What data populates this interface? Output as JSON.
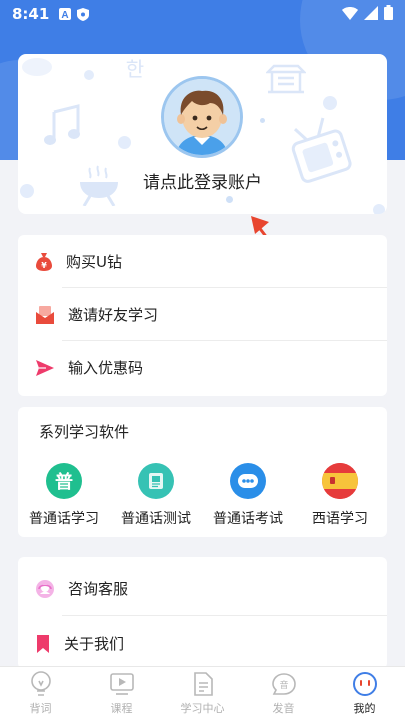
{
  "status_bar": {
    "time": "8:41",
    "left_icons": [
      "a-notification-icon",
      "shield-icon"
    ],
    "right_icons": [
      "wifi-icon",
      "signal-icon",
      "battery-icon"
    ]
  },
  "profile": {
    "login_prompt": "请点此登录账户"
  },
  "menu1": {
    "items": [
      {
        "label": "购买U钻",
        "icon": "money-bag-icon",
        "color": "#e94b3c"
      },
      {
        "label": "邀请好友学习",
        "icon": "invite-envelope-icon",
        "color": "#e94b3c"
      },
      {
        "label": "输入优惠码",
        "icon": "paper-plane-icon",
        "color": "#ee3b6b"
      }
    ]
  },
  "series": {
    "title": "系列学习软件",
    "apps": [
      {
        "label": "普通话学习",
        "icon": "mandarin-learn-icon",
        "glyph": "普",
        "color": "#1fbf8f"
      },
      {
        "label": "普通话测试",
        "icon": "mandarin-test-icon",
        "color": "#36c2b4"
      },
      {
        "label": "普通话考试",
        "icon": "mandarin-exam-icon",
        "color": "#2a8ee8"
      },
      {
        "label": "西语学习",
        "icon": "spain-flag-icon",
        "color": "#e63b3b"
      }
    ]
  },
  "menu2": {
    "items": [
      {
        "label": "咨询客服",
        "icon": "customer-service-icon",
        "color": "#e86fc9"
      },
      {
        "label": "关于我们",
        "icon": "bookmark-icon",
        "color": "#ee3b6b"
      }
    ]
  },
  "nav": {
    "items": [
      {
        "label": "背词",
        "icon": "lightbulb-icon"
      },
      {
        "label": "课程",
        "icon": "play-course-icon"
      },
      {
        "label": "学习中心",
        "icon": "document-icon"
      },
      {
        "label": "发音",
        "icon": "pronunciation-icon"
      },
      {
        "label": "我的",
        "icon": "my-profile-icon",
        "active": true
      }
    ]
  },
  "colors": {
    "brand_blue": "#3f7ee6",
    "background": "#f2f3f7",
    "pointer_red": "#e8452f"
  }
}
